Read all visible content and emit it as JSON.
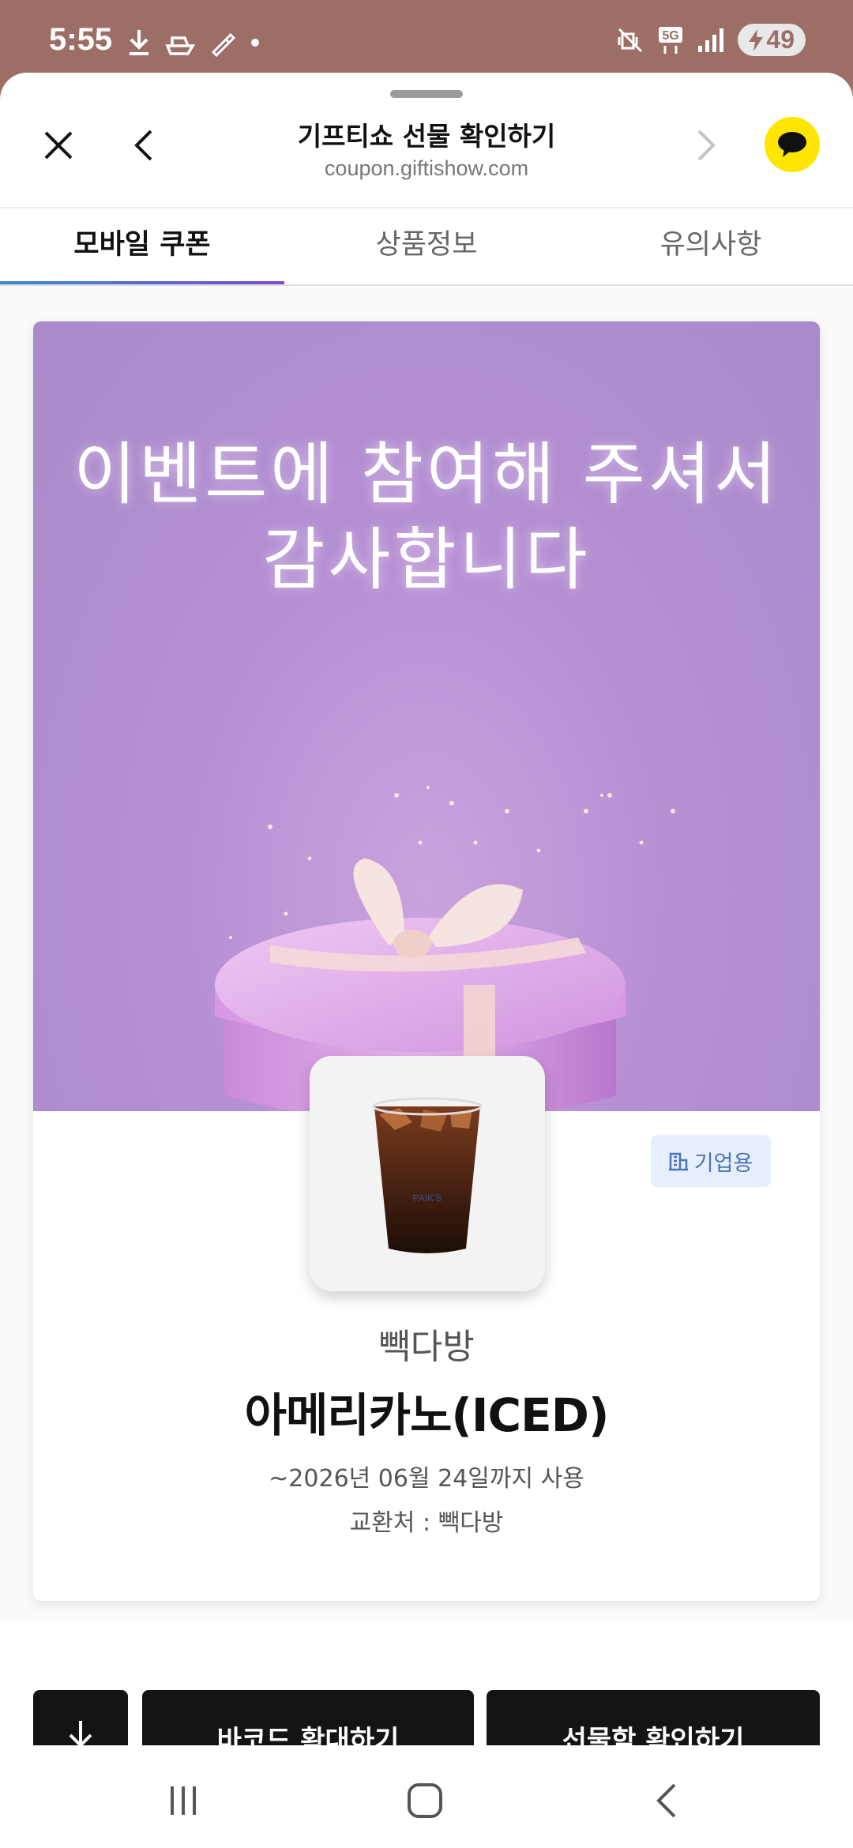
{
  "status_bar": {
    "time": "5:55",
    "left_icons": [
      "download-icon",
      "ship-icon",
      "pencil-ruler-icon",
      "dot-icon"
    ],
    "right_icons": [
      "vibrate-mute-icon",
      "5g-icon",
      "signal-icon"
    ],
    "battery_level": "49"
  },
  "header": {
    "title": "기프티쇼 선물 확인하기",
    "url": "coupon.giftishow.com"
  },
  "tabs": [
    {
      "label": "모바일 쿠폰",
      "active": true
    },
    {
      "label": "상품정보",
      "active": false
    },
    {
      "label": "유의사항",
      "active": false
    }
  ],
  "banner": {
    "line1": "이벤트에 참여해 주셔서",
    "line2": "감사합니다"
  },
  "product": {
    "badge": "기업용",
    "brand": "빽다방",
    "name": "아메리카노(ICED)",
    "expiry": "~2026년 06월 24일까지 사용",
    "exchange": "교환처 : 빽다방"
  },
  "actions": {
    "barcode_label": "바코드 확대하기",
    "giftbox_label": "선물함 확인하기"
  },
  "colors": {
    "banner_purple": "#a98ac9",
    "kakao_yellow": "#ffe600",
    "badge_blue": "#4a74b5",
    "button_black": "#141414"
  }
}
